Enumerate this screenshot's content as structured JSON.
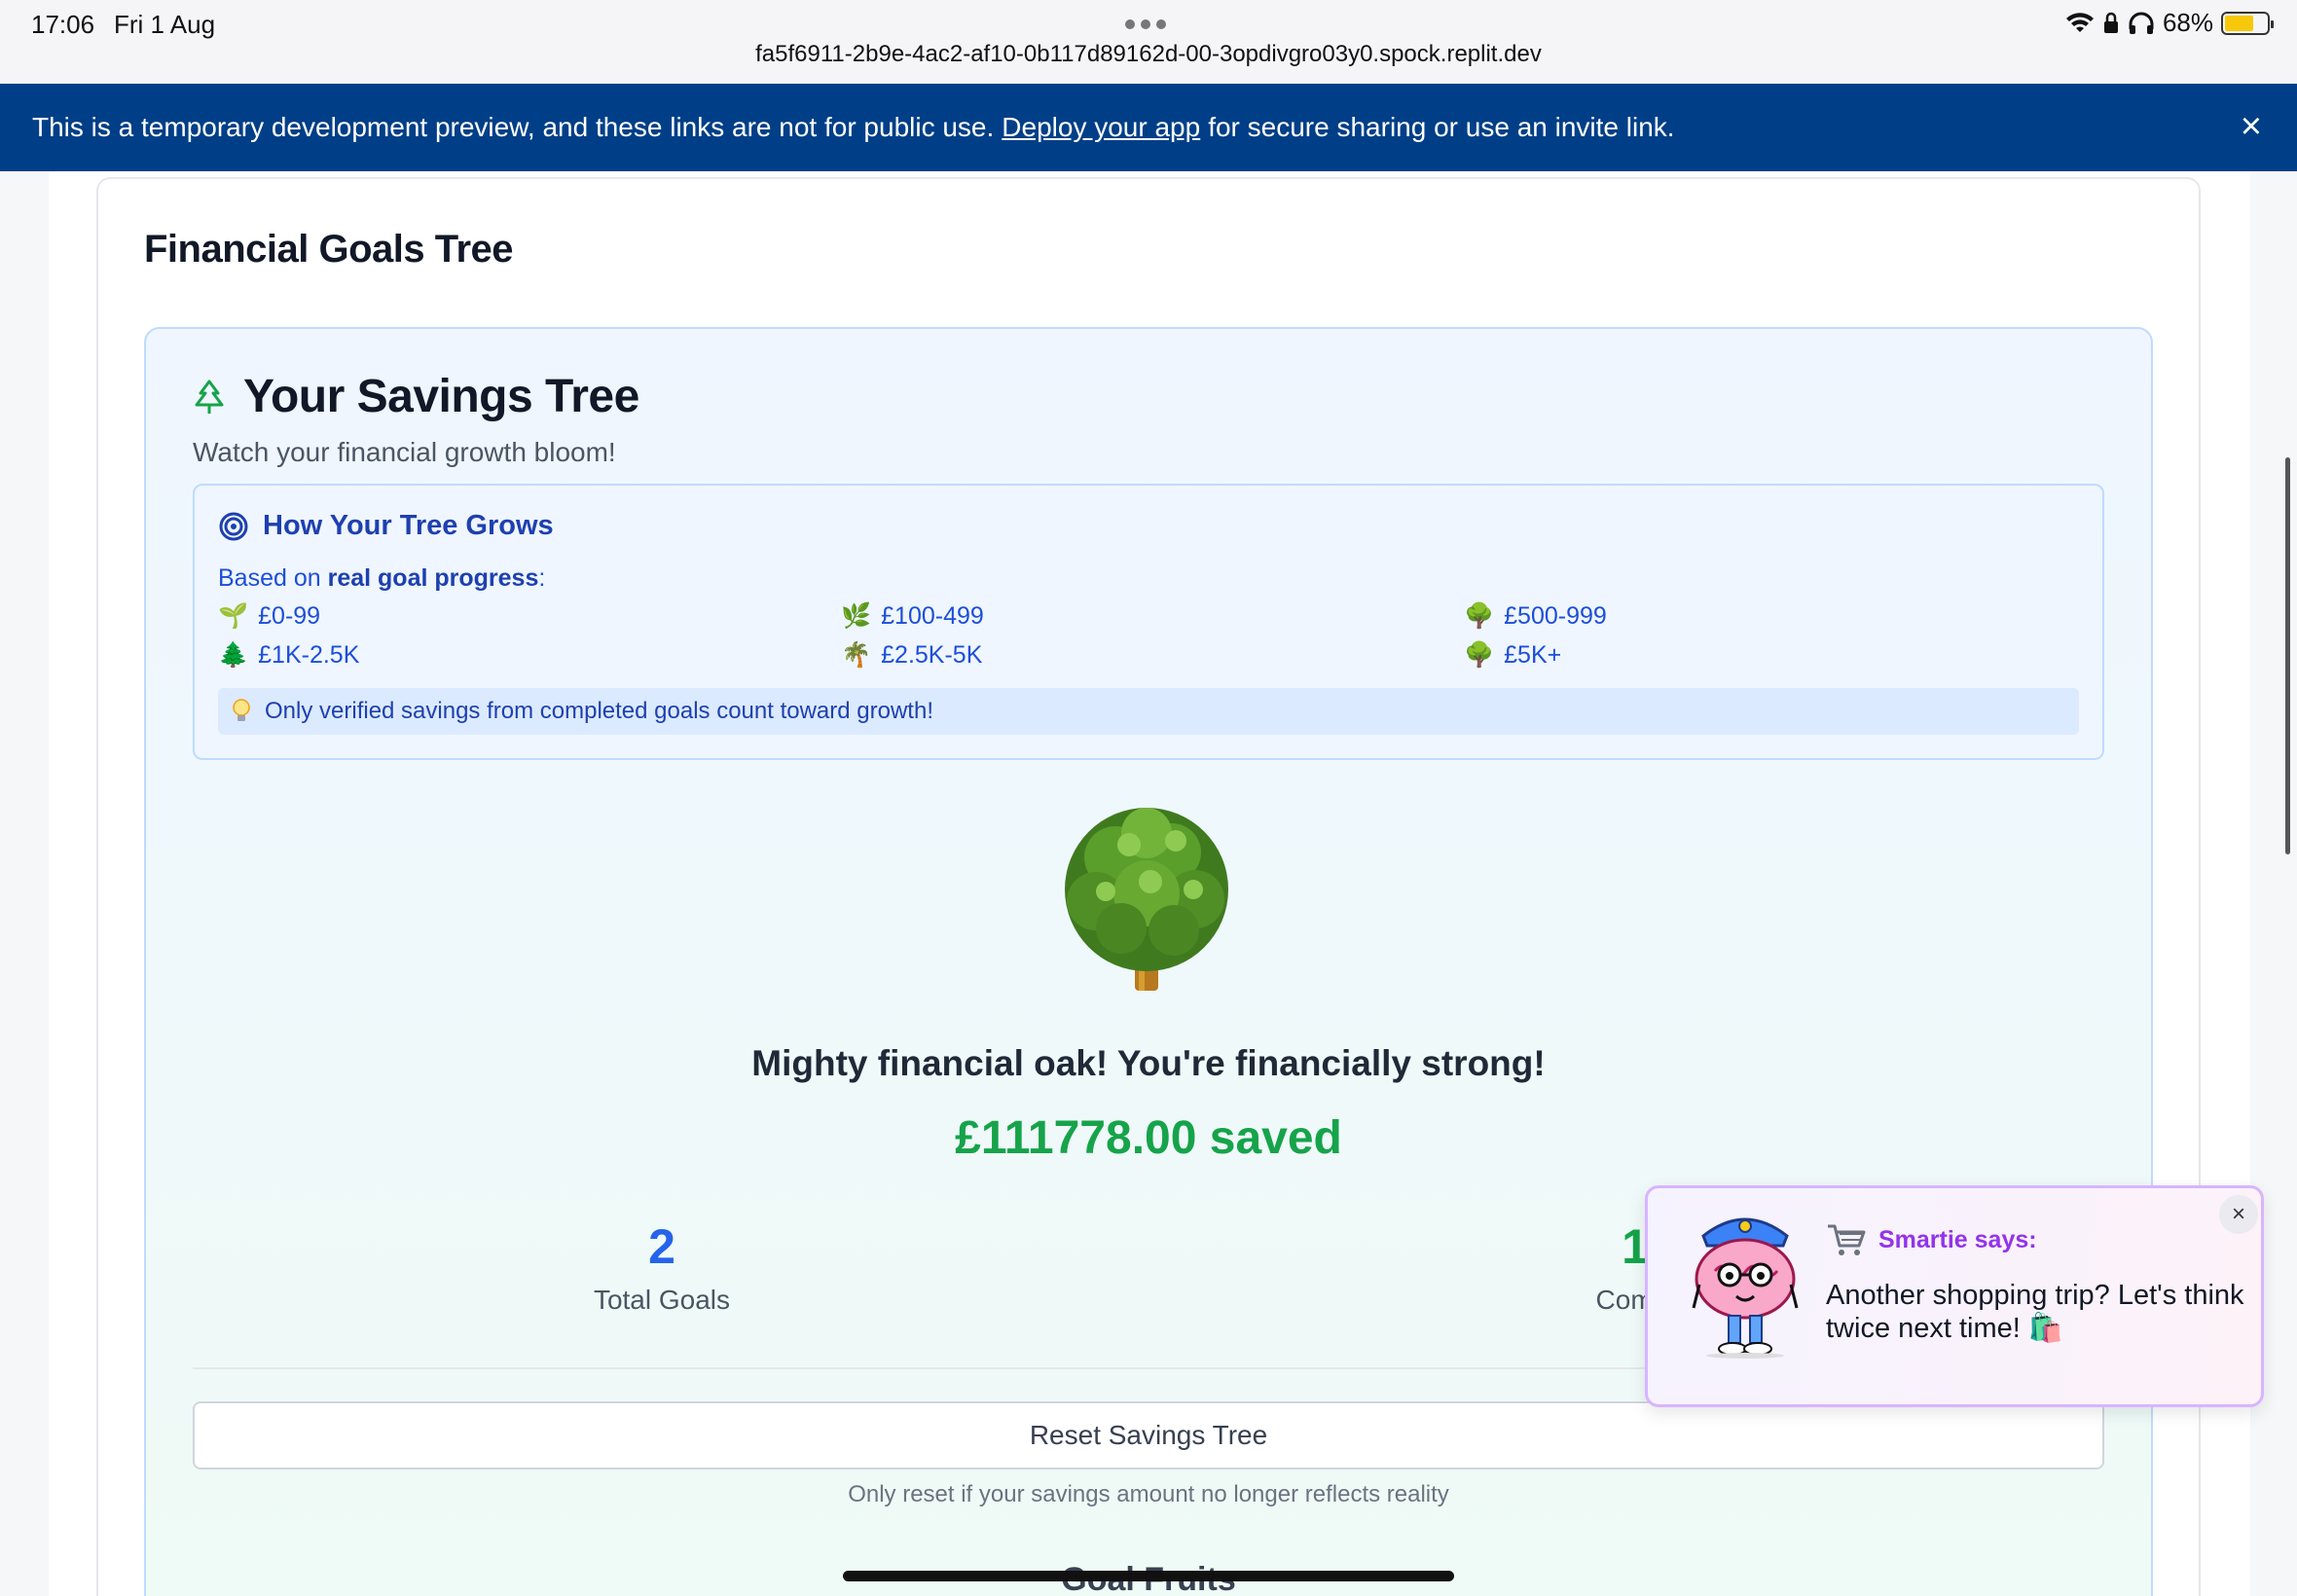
{
  "status_bar": {
    "time": "17:06",
    "date": "Fri 1 Aug",
    "battery": "68%"
  },
  "browser": {
    "url": "fa5f6911-2b9e-4ac2-af10-0b117d89162d-00-3opdivgro03y0.spock.replit.dev"
  },
  "banner": {
    "text_before": "This is a temporary development preview, and these links are not for public use.",
    "link": "Deploy your app",
    "text_after": "for secure sharing or use an invite link.",
    "close": "×"
  },
  "page": {
    "title": "Financial Goals Tree"
  },
  "savings_tree": {
    "title": "Your Savings Tree",
    "subtitle": "Watch your financial growth bloom!",
    "how": {
      "title": "How Your Tree Grows",
      "basis_prefix": "Based on",
      "basis_bold": "real goal progress",
      "basis_suffix": ":",
      "stages": [
        {
          "emoji": "🌱",
          "label": "£0-99"
        },
        {
          "emoji": "🌿",
          "label": "£100-499"
        },
        {
          "emoji": "🌳",
          "label": "£500-999"
        },
        {
          "emoji": "🌲",
          "label": "£1K-2.5K"
        },
        {
          "emoji": "🌴",
          "label": "£2.5K-5K"
        },
        {
          "emoji": "🌳",
          "label": "£5K+"
        }
      ],
      "tip_icon": "lightbulb-icon",
      "tip": "Only verified savings from completed goals count toward growth!"
    },
    "message": "Mighty financial oak! You're financially strong!",
    "saved": "£111778.00 saved",
    "stats": {
      "total_goals": {
        "value": "2",
        "label": "Total Goals",
        "color": "#2563eb"
      },
      "completed": {
        "value": "1",
        "label": "Compl",
        "color": "#16a34a"
      }
    },
    "reset_button": "Reset Savings Tree",
    "reset_note": "Only reset if your savings amount no longer reflects reality",
    "next_section": "Goal Fruits"
  },
  "toast": {
    "icon": "shopping-cart-icon",
    "sender": "Smartie says:",
    "message": "Another shopping trip? Let's think twice next time! 🛍️",
    "close": "×"
  },
  "colors": {
    "banner": "#003f87",
    "accent_blue": "#1e40af",
    "saved_green": "#16a34a",
    "toast_purple": "#9333ea"
  }
}
